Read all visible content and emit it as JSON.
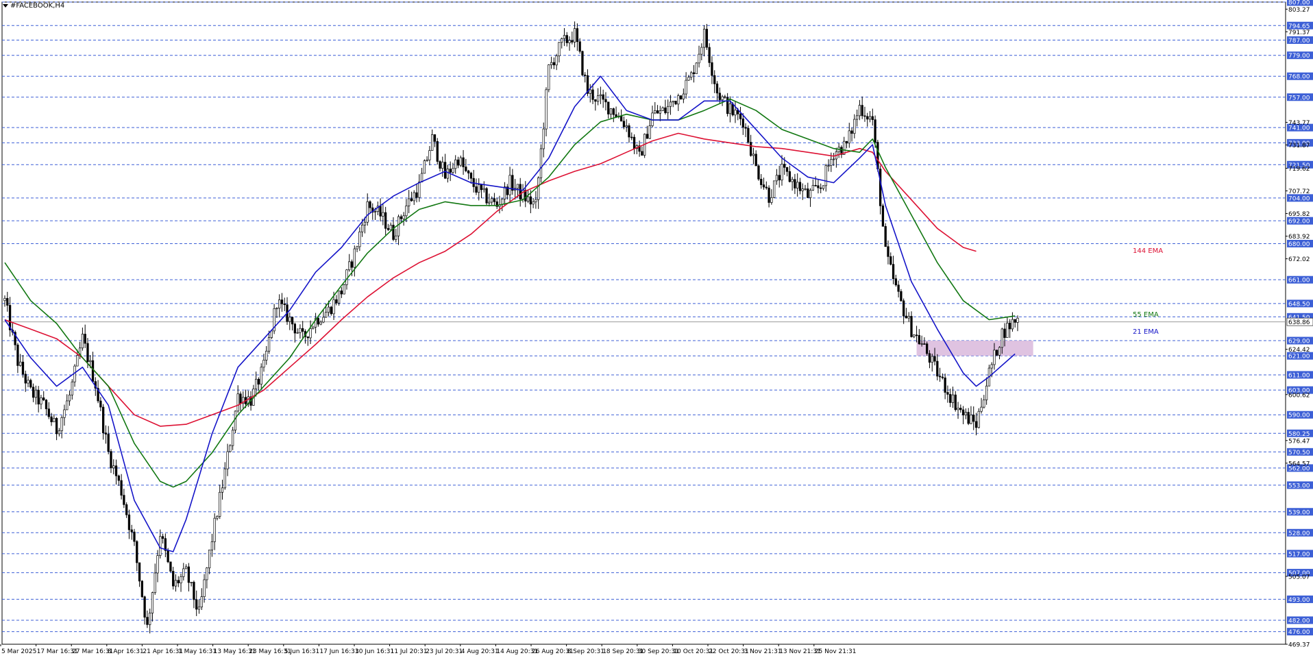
{
  "window": {
    "symbol_title": "#FACEBOOK,H4",
    "menu_icon": "triangle-down-icon"
  },
  "colors": {
    "grid": "#3c5fd6",
    "axis": "#000000",
    "candle": "#000000",
    "ema21": "#1414c8",
    "ema55": "#117711",
    "ema144": "#dd1133",
    "zone": "#d9b8dc",
    "label_bg": "#3c5fd6",
    "label_text": "#ffffff"
  },
  "chart_data": {
    "type": "candlestick",
    "title": "#FACEBOOK,H4",
    "ylim": [
      469.37,
      807.0
    ],
    "price_levels": [
      807.0,
      794.65,
      787.0,
      779.0,
      768.0,
      757.0,
      741.0,
      733.0,
      721.5,
      704.0,
      692.0,
      680.0,
      661.0,
      648.5,
      641.5,
      629.0,
      621.0,
      611.0,
      603.0,
      590.0,
      580.25,
      570.5,
      562.0,
      553.0,
      539.0,
      528.0,
      517.0,
      507.0,
      493.0,
      482.0,
      476.0
    ],
    "y_ticks": [
      {
        "value": 803.27,
        "label": "803.27"
      },
      {
        "value": 791.37,
        "label": "791.37"
      },
      {
        "value": 743.77,
        "label": "743.77"
      },
      {
        "value": 731.87,
        "label": "731.87"
      },
      {
        "value": 719.62,
        "label": "719.62"
      },
      {
        "value": 707.72,
        "label": "707.72"
      },
      {
        "value": 695.82,
        "label": "695.82"
      },
      {
        "value": 683.92,
        "label": "683.92"
      },
      {
        "value": 672.02,
        "label": "672.02"
      },
      {
        "value": 624.42,
        "label": "624.42"
      },
      {
        "value": 600.62,
        "label": "600.62"
      },
      {
        "value": 576.47,
        "label": "576.47"
      },
      {
        "value": 564.57,
        "label": "564.57"
      },
      {
        "value": 505.07,
        "label": "505.07"
      },
      {
        "value": 469.37,
        "label": "469.37"
      }
    ],
    "current_price": {
      "value": 638.86,
      "label": "638.86"
    },
    "x_labels": [
      "5 Mar 2025",
      "17 Mar 16:31",
      "27 Mar 16:31",
      "8 Apr 16:31",
      "21 Apr 16:31",
      "1 May 16:31",
      "13 May 16:31",
      "23 May 16:31",
      "5 Jun 16:31",
      "17 Jun 16:31",
      "30 Jun 16:31",
      "11 Jul 20:31",
      "23 Jul 20:31",
      "4 Aug 20:31",
      "14 Aug 20:31",
      "26 Aug 20:31",
      "8 Sep 20:31",
      "18 Sep 20:31",
      "30 Sep 20:31",
      "10 Oct 20:31",
      "22 Oct 20:31",
      "3 Nov 21:31",
      "13 Nov 21:31",
      "25 Nov 21:31"
    ],
    "price_path": [
      [
        0,
        650
      ],
      [
        5,
        618
      ],
      [
        10,
        602
      ],
      [
        15,
        595
      ],
      [
        20,
        582
      ],
      [
        25,
        600
      ],
      [
        30,
        630
      ],
      [
        35,
        606
      ],
      [
        40,
        570
      ],
      [
        45,
        550
      ],
      [
        50,
        521
      ],
      [
        55,
        478
      ],
      [
        60,
        528
      ],
      [
        65,
        500
      ],
      [
        70,
        507
      ],
      [
        75,
        485
      ],
      [
        80,
        525
      ],
      [
        85,
        560
      ],
      [
        90,
        600
      ],
      [
        95,
        598
      ],
      [
        100,
        615
      ],
      [
        105,
        650
      ],
      [
        110,
        640
      ],
      [
        115,
        630
      ],
      [
        120,
        640
      ],
      [
        125,
        645
      ],
      [
        130,
        655
      ],
      [
        135,
        675
      ],
      [
        140,
        700
      ],
      [
        145,
        695
      ],
      [
        150,
        685
      ],
      [
        155,
        700
      ],
      [
        160,
        710
      ],
      [
        165,
        735
      ],
      [
        170,
        715
      ],
      [
        175,
        725
      ],
      [
        180,
        712
      ],
      [
        185,
        705
      ],
      [
        190,
        700
      ],
      [
        195,
        712
      ],
      [
        200,
        705
      ],
      [
        205,
        700
      ],
      [
        210,
        772
      ],
      [
        215,
        785
      ],
      [
        220,
        790
      ],
      [
        225,
        760
      ],
      [
        230,
        755
      ],
      [
        235,
        750
      ],
      [
        240,
        742
      ],
      [
        245,
        725
      ],
      [
        250,
        748
      ],
      [
        255,
        750
      ],
      [
        260,
        758
      ],
      [
        265,
        768
      ],
      [
        270,
        790
      ],
      [
        275,
        760
      ],
      [
        280,
        750
      ],
      [
        285,
        745
      ],
      [
        290,
        720
      ],
      [
        295,
        705
      ],
      [
        300,
        718
      ],
      [
        305,
        712
      ],
      [
        310,
        705
      ],
      [
        315,
        710
      ],
      [
        320,
        728
      ],
      [
        325,
        732
      ],
      [
        330,
        752
      ],
      [
        335,
        745
      ],
      [
        340,
        675
      ],
      [
        345,
        652
      ],
      [
        350,
        635
      ],
      [
        355,
        625
      ],
      [
        360,
        612
      ],
      [
        365,
        600
      ],
      [
        370,
        590
      ],
      [
        375,
        585
      ],
      [
        380,
        612
      ],
      [
        385,
        633
      ],
      [
        390,
        640
      ]
    ],
    "ema_21": [
      [
        0,
        640
      ],
      [
        10,
        620
      ],
      [
        20,
        605
      ],
      [
        30,
        615
      ],
      [
        40,
        595
      ],
      [
        50,
        545
      ],
      [
        60,
        520
      ],
      [
        65,
        518
      ],
      [
        70,
        535
      ],
      [
        80,
        580
      ],
      [
        90,
        615
      ],
      [
        100,
        630
      ],
      [
        110,
        645
      ],
      [
        120,
        665
      ],
      [
        130,
        678
      ],
      [
        140,
        695
      ],
      [
        150,
        705
      ],
      [
        160,
        712
      ],
      [
        170,
        718
      ],
      [
        180,
        712
      ],
      [
        190,
        710
      ],
      [
        200,
        708
      ],
      [
        210,
        725
      ],
      [
        220,
        752
      ],
      [
        230,
        768
      ],
      [
        240,
        750
      ],
      [
        250,
        745
      ],
      [
        260,
        745
      ],
      [
        270,
        755
      ],
      [
        280,
        755
      ],
      [
        290,
        740
      ],
      [
        300,
        725
      ],
      [
        310,
        715
      ],
      [
        320,
        712
      ],
      [
        330,
        725
      ],
      [
        335,
        732
      ],
      [
        340,
        700
      ],
      [
        350,
        660
      ],
      [
        360,
        635
      ],
      [
        370,
        612
      ],
      [
        375,
        605
      ],
      [
        380,
        610
      ],
      [
        390,
        622
      ]
    ],
    "ema_55": [
      [
        0,
        670
      ],
      [
        10,
        650
      ],
      [
        20,
        638
      ],
      [
        30,
        620
      ],
      [
        40,
        605
      ],
      [
        50,
        575
      ],
      [
        60,
        555
      ],
      [
        65,
        552
      ],
      [
        70,
        555
      ],
      [
        80,
        570
      ],
      [
        90,
        590
      ],
      [
        100,
        605
      ],
      [
        110,
        620
      ],
      [
        120,
        640
      ],
      [
        130,
        658
      ],
      [
        140,
        675
      ],
      [
        150,
        688
      ],
      [
        160,
        698
      ],
      [
        170,
        702
      ],
      [
        180,
        700
      ],
      [
        190,
        700
      ],
      [
        200,
        703
      ],
      [
        210,
        715
      ],
      [
        220,
        732
      ],
      [
        230,
        744
      ],
      [
        240,
        748
      ],
      [
        250,
        745
      ],
      [
        260,
        745
      ],
      [
        270,
        750
      ],
      [
        280,
        756
      ],
      [
        290,
        750
      ],
      [
        300,
        740
      ],
      [
        310,
        735
      ],
      [
        320,
        730
      ],
      [
        330,
        728
      ],
      [
        335,
        735
      ],
      [
        340,
        720
      ],
      [
        350,
        695
      ],
      [
        360,
        670
      ],
      [
        370,
        650
      ],
      [
        380,
        640
      ],
      [
        390,
        642
      ]
    ],
    "ema_144": [
      [
        0,
        640
      ],
      [
        10,
        635
      ],
      [
        20,
        630
      ],
      [
        30,
        620
      ],
      [
        40,
        605
      ],
      [
        50,
        590
      ],
      [
        60,
        584
      ],
      [
        70,
        585
      ],
      [
        80,
        590
      ],
      [
        90,
        595
      ],
      [
        100,
        603
      ],
      [
        110,
        615
      ],
      [
        120,
        627
      ],
      [
        130,
        640
      ],
      [
        140,
        652
      ],
      [
        150,
        662
      ],
      [
        160,
        670
      ],
      [
        170,
        676
      ],
      [
        180,
        685
      ],
      [
        190,
        697
      ],
      [
        200,
        707
      ],
      [
        210,
        713
      ],
      [
        220,
        718
      ],
      [
        230,
        722
      ],
      [
        240,
        728
      ],
      [
        250,
        734
      ],
      [
        260,
        738
      ],
      [
        270,
        735
      ],
      [
        280,
        733
      ],
      [
        290,
        731
      ],
      [
        300,
        730
      ],
      [
        310,
        728
      ],
      [
        320,
        726
      ],
      [
        330,
        730
      ],
      [
        335,
        728
      ],
      [
        340,
        718
      ],
      [
        350,
        703
      ],
      [
        360,
        688
      ],
      [
        370,
        678
      ],
      [
        375,
        676
      ]
    ],
    "zone": {
      "from": 621.0,
      "to": 629.0
    },
    "ema_labels": [
      {
        "text": "144 EMA",
        "series": "ema_144",
        "at_price": 676.5
      },
      {
        "text": "55 EMA",
        "series": "ema_55",
        "at_price": 643.0
      },
      {
        "text": "21 EMA",
        "series": "ema_21",
        "at_price": 634.0
      }
    ]
  }
}
